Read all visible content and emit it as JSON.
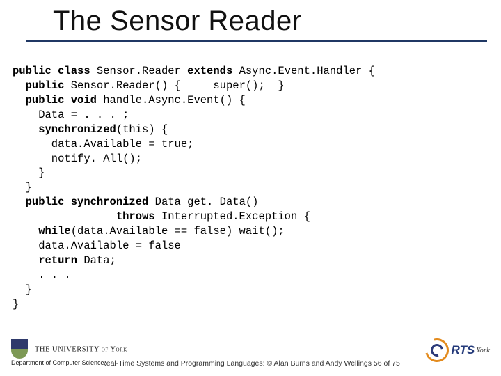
{
  "title": "The Sensor Reader",
  "code": {
    "l1a": "public class",
    "l1b": " Sensor.Reader ",
    "l1c": "extends",
    "l1d": " Async.Event.Handler {",
    "l2a": "  public",
    "l2b": " Sensor.Reader() {     super();  }",
    "l3a": "  public void",
    "l3b": " handle.Async.Event() {",
    "l4": "    Data = . . . ;",
    "l5a": "    synchronized",
    "l5b": "(this) {",
    "l6": "      data.Available = true;",
    "l7": "      notify. All();",
    "l8": "    }",
    "l9": "  }",
    "l10a": "  public synchronized",
    "l10b": " Data get. Data()",
    "l11a": "                throws",
    "l11b": " Interrupted.Exception {",
    "l12a": "    while",
    "l12b": "(data.Available == false) wait();",
    "l13": "    data.Available = false",
    "l14a": "    return",
    "l14b": " Data;",
    "l15": "    . . .",
    "l16": "  }",
    "l17": "}"
  },
  "footer": {
    "uni_line1": "THE UNIVERSITY of York",
    "uni_line2": "Department of Computer Science",
    "center": "Real-Time Systems and Programming Languages: © Alan Burns and Andy Wellings  56 of 75",
    "rts_main": "RTS",
    "rts_sub": "York",
    "page_current": 56,
    "page_total": 75
  }
}
